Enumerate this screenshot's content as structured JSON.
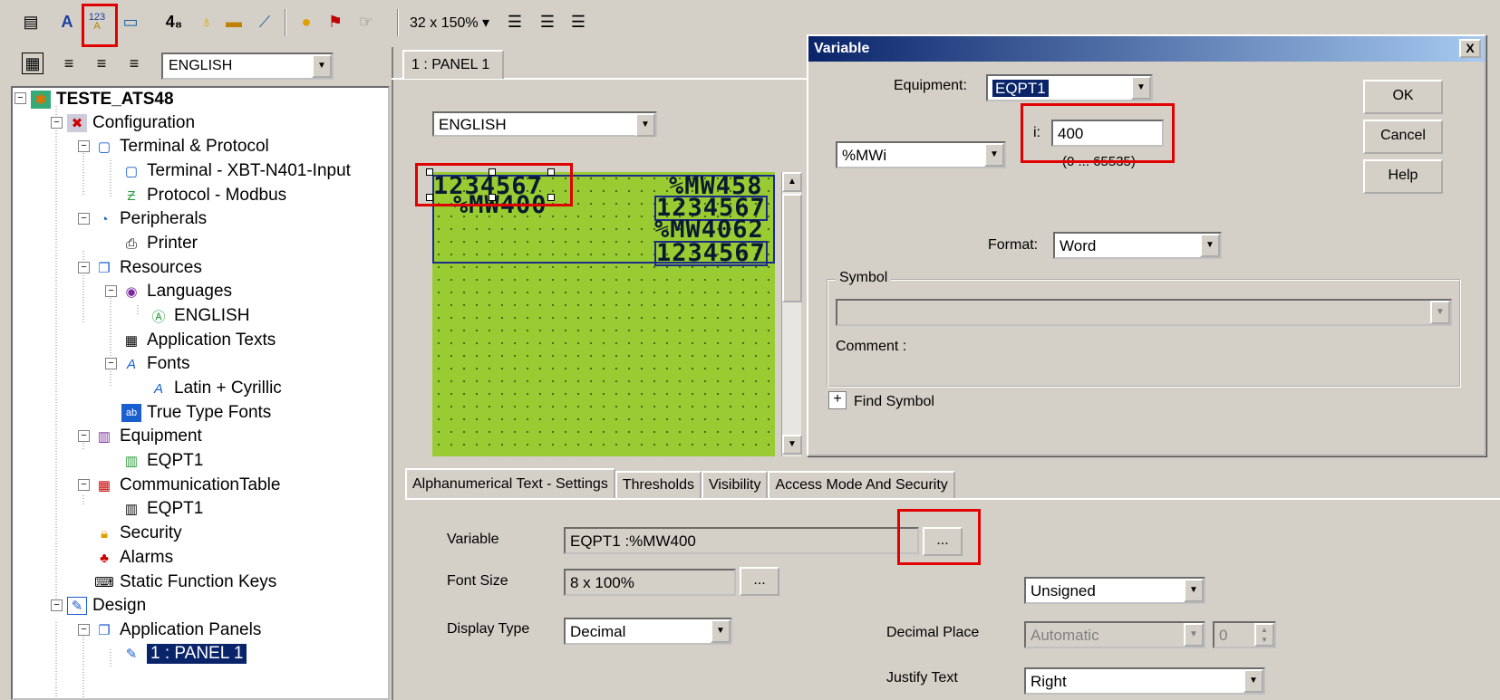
{
  "toolbar": {
    "zoom": "32 x 150%"
  },
  "tree": {
    "language": "ENGLISH",
    "items": [
      {
        "label": "TESTE_ATS48"
      },
      {
        "label": "Configuration"
      },
      {
        "label": "Terminal & Protocol"
      },
      {
        "label": "Terminal - XBT-N401-Input"
      },
      {
        "label": "Protocol - Modbus"
      },
      {
        "label": "Peripherals"
      },
      {
        "label": "Printer"
      },
      {
        "label": "Resources"
      },
      {
        "label": "Languages"
      },
      {
        "label": "ENGLISH"
      },
      {
        "label": "Application Texts"
      },
      {
        "label": "Fonts"
      },
      {
        "label": "Latin + Cyrillic"
      },
      {
        "label": "True Type Fonts"
      },
      {
        "label": "Equipment"
      },
      {
        "label": "EQPT1"
      },
      {
        "label": "CommunicationTable"
      },
      {
        "label": "EQPT1"
      },
      {
        "label": "Security"
      },
      {
        "label": "Alarms"
      },
      {
        "label": "Static Function Keys"
      },
      {
        "label": "Design"
      },
      {
        "label": "Application Panels"
      },
      {
        "label": "1 : PANEL 1"
      }
    ]
  },
  "panel": {
    "tab_label": "1 : PANEL 1",
    "language": "ENGLISH",
    "lcd": {
      "left_value": "1234567",
      "left_var": "%MW400",
      "right_var1": "%MW458",
      "right_value1": "1234567",
      "right_var2": "%MW4062",
      "right_value2": "1234567"
    }
  },
  "settings": {
    "tabs": [
      "Alphanumerical Text - Settings",
      "Thresholds",
      "Visibility",
      "Access Mode And Security"
    ],
    "variable_label": "Variable",
    "variable_value": "EQPT1 :%MW400",
    "browse_label": "...",
    "font_size_label": "Font Size",
    "font_size_value": "8 x 100%",
    "display_type_label": "Display Type",
    "display_type_value": "Decimal",
    "sign_value": "Unsigned",
    "decimal_place_label": "Decimal Place",
    "decimal_place_value": "Automatic",
    "decimal_count": "0",
    "justify_label": "Justify Text",
    "justify_value": "Right"
  },
  "dialog": {
    "title": "Variable",
    "close_label": "X",
    "equipment_label": "Equipment:",
    "equipment_value": "EQPT1",
    "type_value": "%MWi",
    "index_label": "i:",
    "index_value": "400",
    "index_range": "(0 ... 65535)",
    "format_label": "Format:",
    "format_value": "Word",
    "symbol_group": "Symbol",
    "comment_label": "Comment :",
    "find_symbol_label": "Find Symbol",
    "ok_label": "OK",
    "cancel_label": "Cancel",
    "help_label": "Help"
  }
}
